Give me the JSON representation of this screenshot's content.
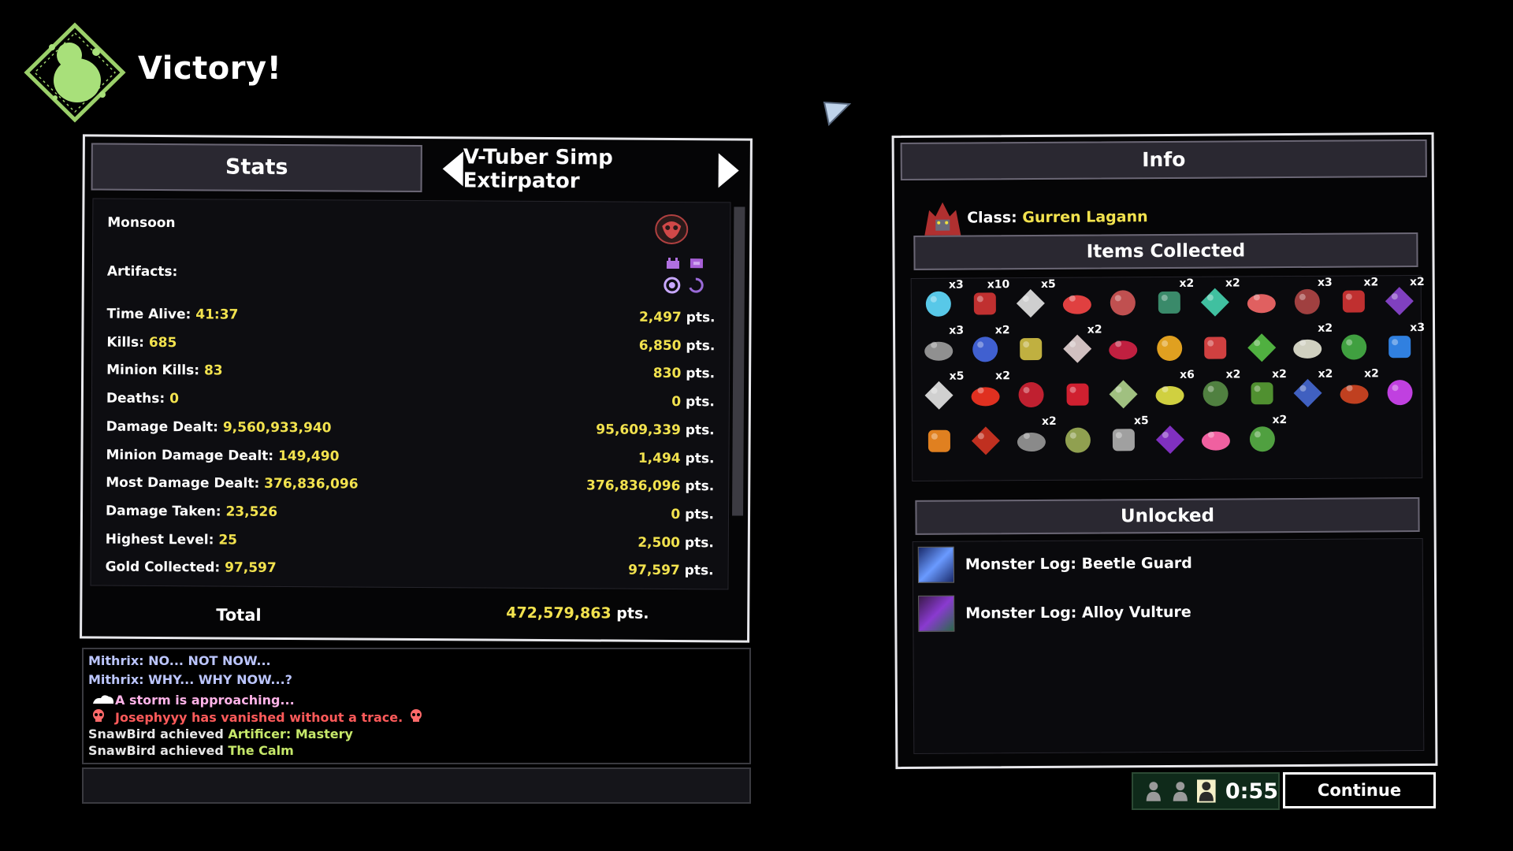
{
  "header": {
    "title": "Victory!",
    "emblem_icon": "victory-emblem-icon"
  },
  "stats_panel": {
    "tab_label": "Stats",
    "run_title": "V-Tuber Simp Extirpator",
    "difficulty": "Monsoon",
    "difficulty_icon": "monsoon-skull-icon",
    "artifacts_label": "Artifacts:",
    "artifact_icons": [
      "artifact-command-icon",
      "artifact-chaos-icon",
      "artifact-sacrifice-icon",
      "artifact-evolution-icon"
    ],
    "rows": [
      {
        "label": "Time Alive:",
        "value": "41:37",
        "points": "2,497"
      },
      {
        "label": "Kills:",
        "value": "685",
        "points": "6,850"
      },
      {
        "label": "Minion Kills:",
        "value": "83",
        "points": "830"
      },
      {
        "label": "Deaths:",
        "value": "0",
        "points": "0"
      },
      {
        "label": "Damage Dealt:",
        "value": "9,560,933,940",
        "points": "95,609,339"
      },
      {
        "label": "Minion Damage Dealt:",
        "value": "149,490",
        "points": "1,494"
      },
      {
        "label": "Most Damage Dealt:",
        "value": "376,836,096",
        "points": "376,836,096"
      },
      {
        "label": "Damage Taken:",
        "value": "23,526",
        "points": "0"
      },
      {
        "label": "Highest Level:",
        "value": "25",
        "points": "2,500"
      },
      {
        "label": "Gold Collected:",
        "value": "97,597",
        "points": "97,597"
      }
    ],
    "points_suffix": "pts.",
    "total_label": "Total",
    "total_value": "472,579,863",
    "total_suffix": "pts."
  },
  "chat": {
    "lines": [
      {
        "parts": [
          {
            "text": "Mithrix: NO... NOT NOW...",
            "color": "#bcc6ff"
          }
        ]
      },
      {
        "parts": [
          {
            "text": "Mithrix: WHY... WHY NOW...?",
            "color": "#bcc6ff"
          }
        ]
      },
      {
        "parts": [
          {
            "text": "A storm is approaching...",
            "color": "#ffb3e8"
          }
        ],
        "icon": "storm-cloud-icon"
      },
      {
        "parts": [
          {
            "text": "Josephyyy has vanished without a trace.",
            "color": "#ff5a5a"
          }
        ],
        "icon": "skull-icon"
      },
      {
        "parts": [
          {
            "text": "SnawBird achieved ",
            "color": "#e6e6e6"
          },
          {
            "text": "Artificer: Mastery",
            "color": "#c6e86a"
          }
        ]
      },
      {
        "parts": [
          {
            "text": "SnawBird achieved ",
            "color": "#e6e6e6"
          },
          {
            "text": "The Calm",
            "color": "#c6e86a"
          }
        ]
      }
    ]
  },
  "info_panel": {
    "tab_label": "Info",
    "class_label": "Class:",
    "class_value": "Gurren Lagann",
    "class_icon": "gurren-lagann-portrait-icon",
    "items_label": "Items Collected",
    "items": [
      {
        "icon": "crystal-icon",
        "count": "x3",
        "color": "#58c8e8"
      },
      {
        "icon": "glasses-icon",
        "count": "x10",
        "color": "#c03030"
      },
      {
        "icon": "fork-icon",
        "count": "x5",
        "color": "#cfcfcf"
      },
      {
        "icon": "jellyfish-icon",
        "count": "",
        "color": "#e04040"
      },
      {
        "icon": "rock-icon",
        "count": "",
        "color": "#c05050"
      },
      {
        "icon": "wreath-icon",
        "count": "x2",
        "color": "#3a8a6a"
      },
      {
        "icon": "tooth-icon",
        "count": "x2",
        "color": "#40c0a0"
      },
      {
        "icon": "mask-icon",
        "count": "",
        "color": "#e06060"
      },
      {
        "icon": "leaf-icon",
        "count": "x3",
        "color": "#a04040"
      },
      {
        "icon": "crowbar-icon",
        "count": "x2",
        "color": "#c03030"
      },
      {
        "icon": "void-orb-icon",
        "count": "x2",
        "color": "#8040c0"
      },
      {
        "icon": "shell-icon",
        "count": "x3",
        "color": "#909090"
      },
      {
        "icon": "brain-bug-icon",
        "count": "x2",
        "color": "#4060d0"
      },
      {
        "icon": "figure-icon",
        "count": "",
        "color": "#c0b040"
      },
      {
        "icon": "monitor-icon",
        "count": "x2",
        "color": "#d0c0c0"
      },
      {
        "icon": "meat-icon",
        "count": "",
        "color": "#c02040"
      },
      {
        "icon": "gold-beetle-icon",
        "count": "",
        "color": "#e0a020"
      },
      {
        "icon": "hammer-icon",
        "count": "",
        "color": "#d04040"
      },
      {
        "icon": "sprout-icon",
        "count": "",
        "color": "#50b040"
      },
      {
        "icon": "scroll-icon",
        "count": "x2",
        "color": "#d0d0c0"
      },
      {
        "icon": "spiral-icon",
        "count": "",
        "color": "#40a040"
      },
      {
        "icon": "feather-icon",
        "count": "x3",
        "color": "#3080e0"
      },
      {
        "icon": "sword-icon",
        "count": "x5",
        "color": "#d0d0d0"
      },
      {
        "icon": "chili-icon",
        "count": "x2",
        "color": "#e03020"
      },
      {
        "icon": "heart-icon",
        "count": "",
        "color": "#c02030"
      },
      {
        "icon": "mouth-icon",
        "count": "",
        "color": "#d02030"
      },
      {
        "icon": "necklace-icon",
        "count": "",
        "color": "#a0c080"
      },
      {
        "icon": "syringe-icon",
        "count": "x6",
        "color": "#d0d040"
      },
      {
        "icon": "belt-icon",
        "count": "x2",
        "color": "#508040"
      },
      {
        "icon": "snail-icon",
        "count": "x2",
        "color": "#509030"
      },
      {
        "icon": "teapot-icon",
        "count": "x2",
        "color": "#4060c0"
      },
      {
        "icon": "guitar-icon",
        "count": "x2",
        "color": "#c04020"
      },
      {
        "icon": "purple-brain-icon",
        "count": "",
        "color": "#c040e0"
      },
      {
        "icon": "carrot-icon",
        "count": "",
        "color": "#e08020"
      },
      {
        "icon": "mushroom-icon",
        "count": "",
        "color": "#c03020"
      },
      {
        "icon": "canister-icon",
        "count": "x2",
        "color": "#8a8a8a"
      },
      {
        "icon": "slug-icon",
        "count": "",
        "color": "#90a050"
      },
      {
        "icon": "pipe-icon",
        "count": "x5",
        "color": "#a0a0a0"
      },
      {
        "icon": "eye-spiral-icon",
        "count": "",
        "color": "#8030c0"
      },
      {
        "icon": "pink-gem-icon",
        "count": "",
        "color": "#f060a0"
      },
      {
        "icon": "cucumber-icon",
        "count": "x2",
        "color": "#50a040"
      }
    ],
    "unlocked_label": "Unlocked",
    "unlocked": [
      {
        "label": "Monster Log: Beetle Guard",
        "icon": "beetle-guard-log-icon"
      },
      {
        "label": "Monster Log: Alloy Vulture",
        "icon": "alloy-vulture-log-icon"
      }
    ]
  },
  "vote": {
    "voters": [
      {
        "ready": false
      },
      {
        "ready": false
      },
      {
        "ready": true
      }
    ],
    "timer": "0:55"
  },
  "continue_label": "Continue"
}
